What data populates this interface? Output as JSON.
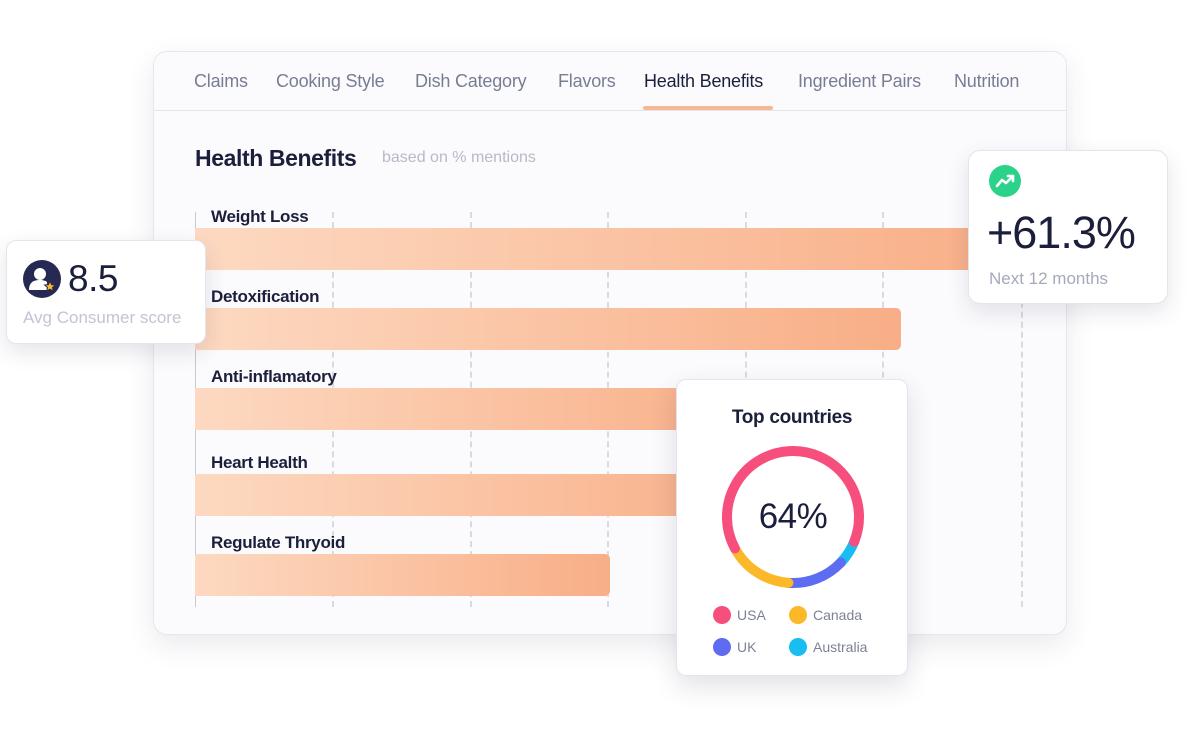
{
  "tabs": [
    {
      "label": "Claims",
      "active": false
    },
    {
      "label": "Cooking Style",
      "active": false
    },
    {
      "label": "Dish Category",
      "active": false
    },
    {
      "label": "Flavors",
      "active": false
    },
    {
      "label": "Health Benefits",
      "active": true
    },
    {
      "label": "Ingredient Pairs",
      "active": false
    },
    {
      "label": "Nutrition",
      "active": false
    }
  ],
  "section": {
    "title": "Health Benefits",
    "subtitle": "based on % mentions"
  },
  "chart_data": {
    "type": "bar",
    "orientation": "horizontal",
    "categories": [
      "Weight Loss",
      "Detoxification",
      "Anti-inflamatory",
      "Heart Health",
      "Regulate Thryoid"
    ],
    "values": [
      100,
      85,
      69,
      69,
      50
    ],
    "gradient": [
      "#fdd9c1",
      "#f8ae86"
    ],
    "grid": true
  },
  "consumer_score": {
    "value": "8.5",
    "label": "Avg Consumer score",
    "icon": "user-star-icon"
  },
  "trend": {
    "value": "+61.3%",
    "label": "Next 12 months",
    "icon": "trending-up-icon",
    "color": "#2bd38a"
  },
  "top_countries": {
    "title": "Top countries",
    "center_label": "64%",
    "segments": [
      {
        "name": "USA",
        "color": "#f74f7d",
        "share": 0.64
      },
      {
        "name": "Canada",
        "color": "#fbb829",
        "share": 0.16
      },
      {
        "name": "UK",
        "color": "#5d6cf0",
        "share": 0.14
      },
      {
        "name": "Australia",
        "color": "#18bdf2",
        "share": 0.06
      }
    ]
  }
}
